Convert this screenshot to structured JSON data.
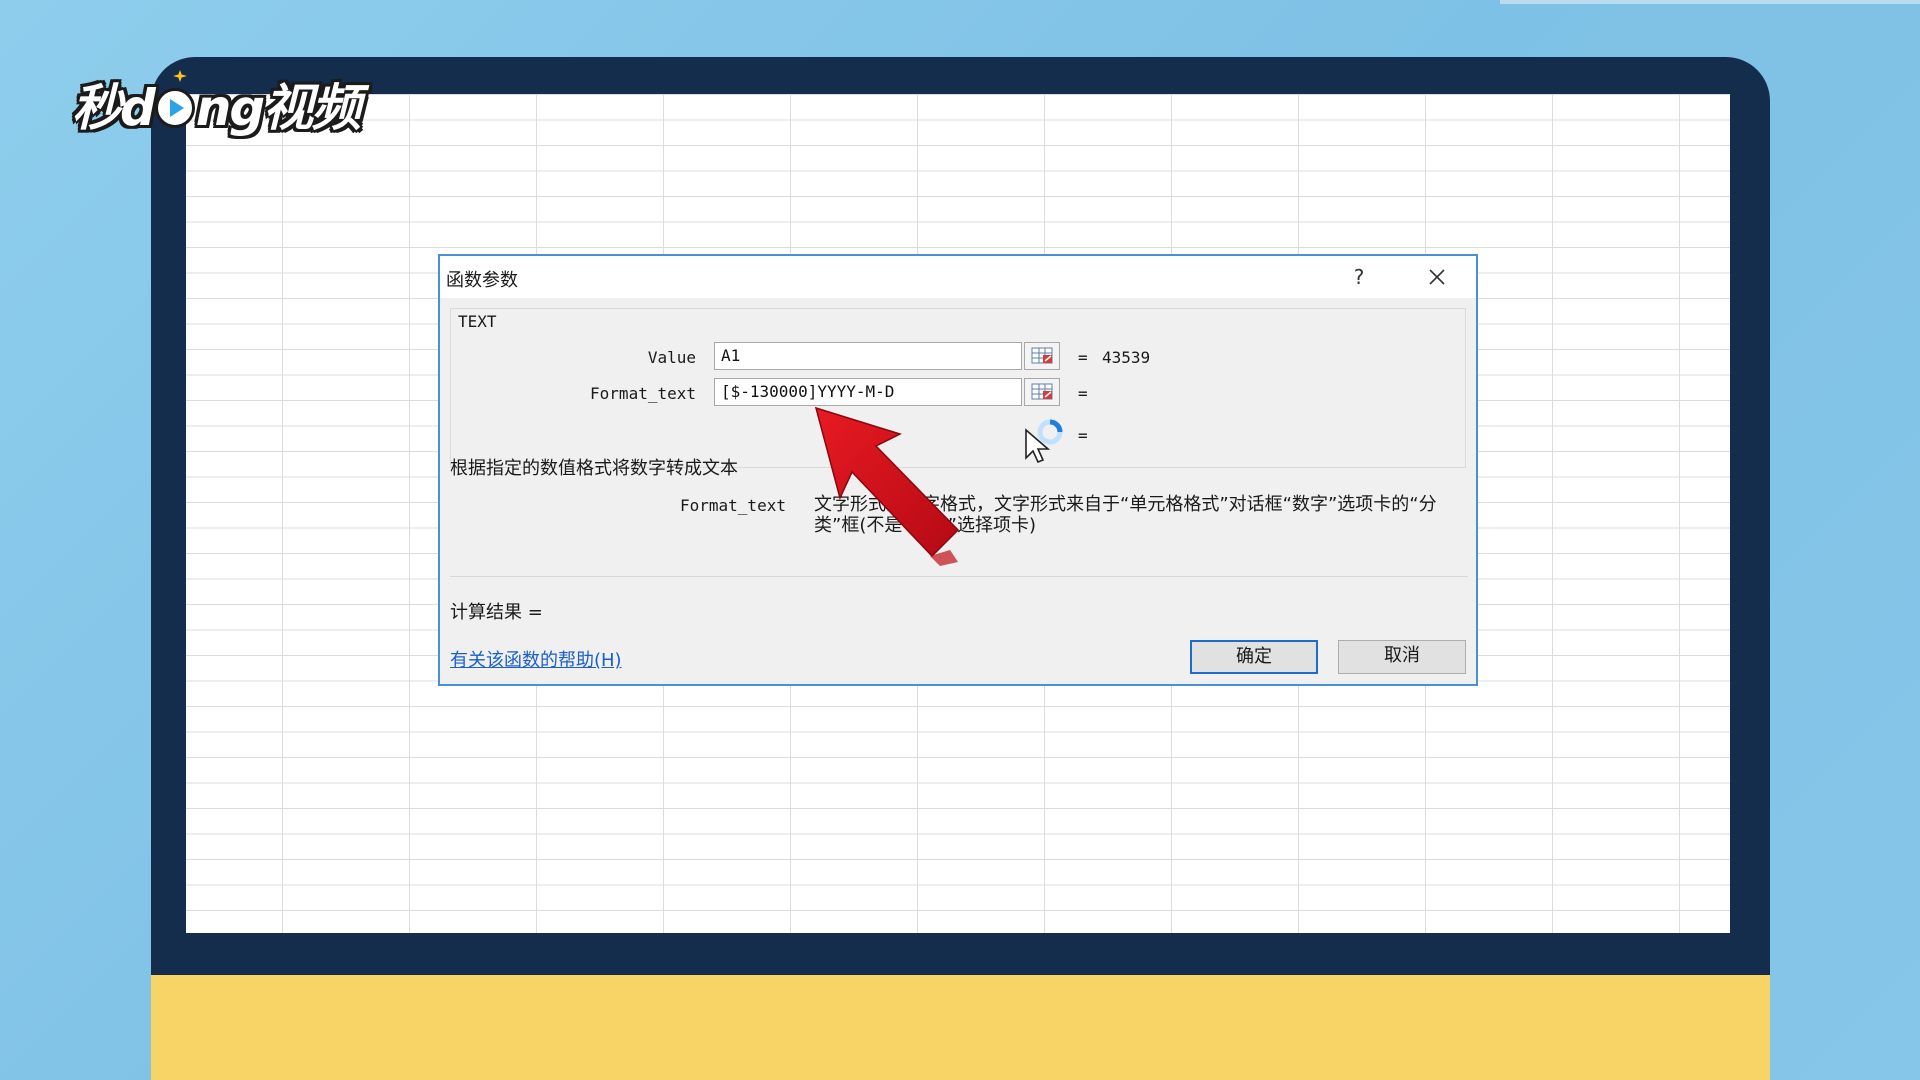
{
  "logo": {
    "prefix": "秒d",
    "suffix": "ng视频"
  },
  "dialog": {
    "title": "函数参数",
    "help_symbol": "?",
    "function_name": "TEXT",
    "args": [
      {
        "label": "Value",
        "input": "A1",
        "result": "43539"
      },
      {
        "label": "Format_text",
        "input": "[$-130000]YYYY-M-D",
        "result": ""
      }
    ],
    "extra_eq": "=",
    "eq_symbol": "=",
    "description": "根据指定的数值格式将数字转成文本",
    "param_help_name": "Format_text",
    "param_help_text": "文字形式的数字格式，文字形式来自于“单元格格式”对话框“数字”选项卡的“分类”框(不是“常规”选择项卡)",
    "result_label": "计算结果 =",
    "help_link": "有关该函数的帮助(H)",
    "ok_label": "确定",
    "cancel_label": "取消"
  },
  "colors": {
    "background": "#86c6e8",
    "monitor_frame": "#152d4c",
    "monitor_base": "#f8d466",
    "dialog_border": "#4a90d9",
    "link": "#1a5fcc",
    "arrow": "#d10e1c"
  },
  "icons": {
    "close": "close-icon",
    "ref": "range-select-icon",
    "cursor": "busy-cursor-icon",
    "arrow": "red-arrow-icon"
  }
}
